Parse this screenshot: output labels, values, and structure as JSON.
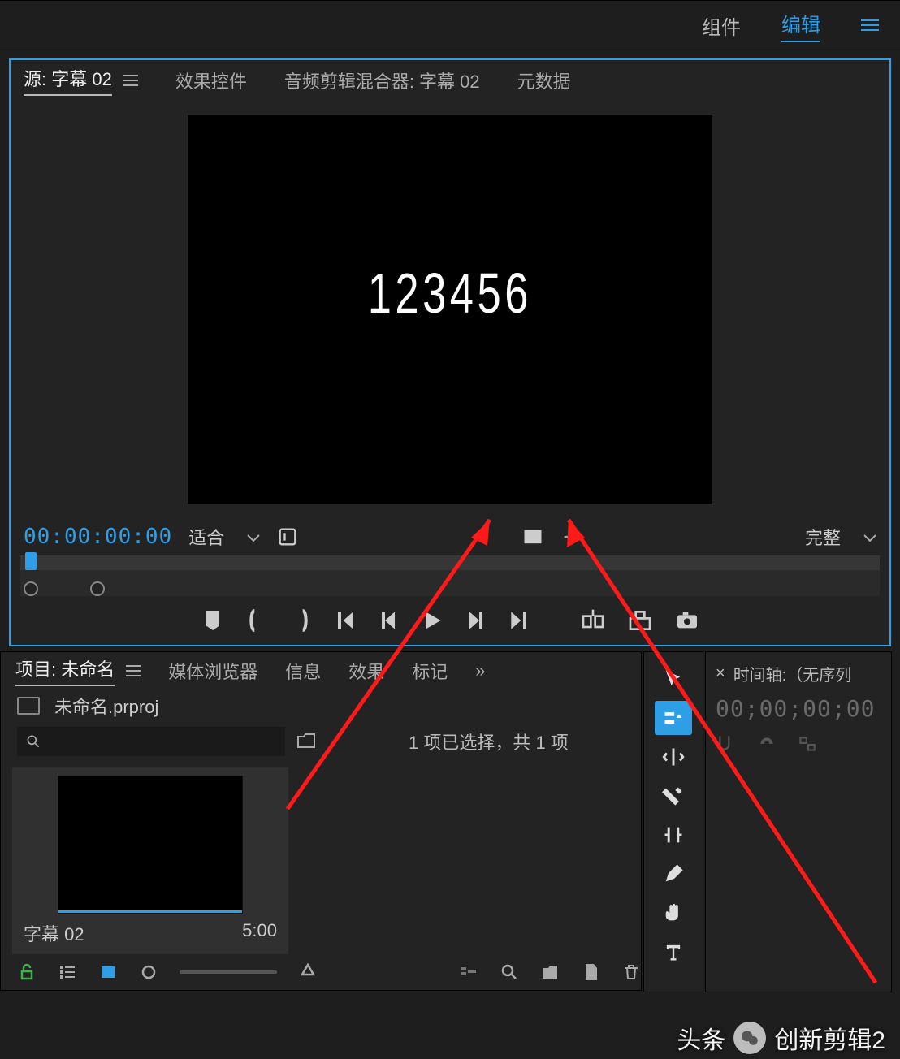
{
  "top": {
    "tab1": "组件",
    "tab2": "编辑"
  },
  "source": {
    "tabs": {
      "t1": "源: 字幕 02",
      "t2": "效果控件",
      "t3": "音频剪辑混合器: 字幕 02",
      "t4": "元数据"
    },
    "videoText": "123456",
    "timecode": "00:00:00:00",
    "zoomLabel": "适合",
    "fullLabel": "完整"
  },
  "project": {
    "tabs": {
      "t1": "项目: 未命名",
      "t2": "媒体浏览器",
      "t3": "信息",
      "t4": "效果",
      "t5": "标记",
      "more": "»"
    },
    "projectName": "未命名.prproj",
    "searchPlaceholder": "",
    "selectionInfo": "1 项已选择，共 1 项",
    "clip": {
      "name": "字幕 02",
      "dur": "5:00"
    }
  },
  "timeline": {
    "title": "时间轴:（无序列",
    "closeGlyph": "×",
    "timecode": "00;00;00;00"
  },
  "watermark": {
    "t1": "头条",
    "t2": "创新剪辑2"
  }
}
